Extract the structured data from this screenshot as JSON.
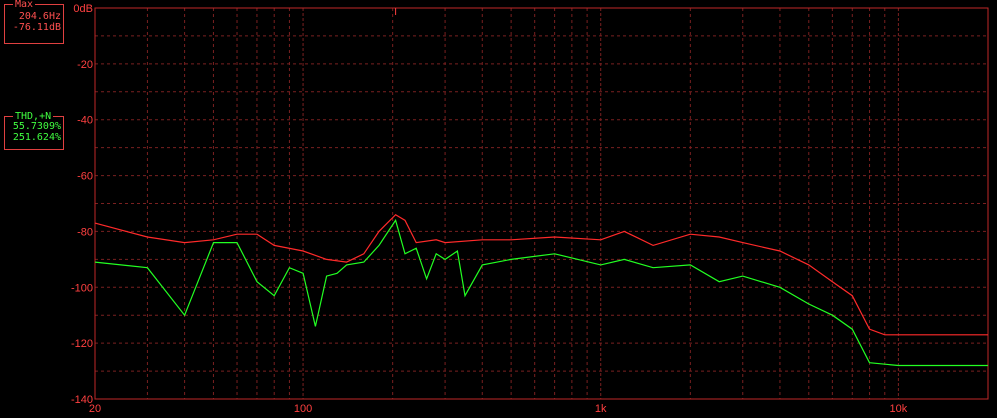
{
  "max_panel": {
    "title": "Max",
    "freq": "204.6Hz",
    "level": "-76.11dB"
  },
  "thd_panel": {
    "title": "THD,+N",
    "value1": "55.7309%",
    "value2": "251.624%"
  },
  "colors": {
    "background": "#000000",
    "grid": "#7a2020",
    "red_trace": "#ff2a2a",
    "green_trace": "#22ff22",
    "label": "#ff4040"
  },
  "chart_data": {
    "type": "line",
    "xscale": "log",
    "xlim": [
      20,
      20000
    ],
    "ylim": [
      -140,
      0
    ],
    "grid": true,
    "x_tick_labels": [
      {
        "x": 20,
        "label": "20"
      },
      {
        "x": 100,
        "label": "100"
      },
      {
        "x": 1000,
        "label": "1k"
      },
      {
        "x": 10000,
        "label": "10k"
      }
    ],
    "y_tick_labels": [
      {
        "y": 0,
        "label": "0dB"
      },
      {
        "y": -20,
        "label": "-20"
      },
      {
        "y": -40,
        "label": "-40"
      },
      {
        "y": -60,
        "label": "-60"
      },
      {
        "y": -80,
        "label": "-80"
      },
      {
        "y": -100,
        "label": "-100"
      },
      {
        "y": -120,
        "label": "-120"
      },
      {
        "y": -140,
        "label": "-140"
      }
    ],
    "marker_x": 204.6,
    "series": [
      {
        "color": "#ff2a2a",
        "x": [
          20,
          30,
          40,
          50,
          60,
          70,
          80,
          100,
          120,
          140,
          160,
          180,
          204.6,
          220,
          240,
          280,
          300,
          400,
          500,
          700,
          1000,
          1200,
          1500,
          2000,
          2500,
          3000,
          4000,
          5000,
          6000,
          7000,
          8000,
          9000,
          10000,
          12000,
          15000,
          20000
        ],
        "y": [
          -77,
          -82,
          -84,
          -83,
          -81,
          -81,
          -85,
          -87,
          -90,
          -91,
          -88,
          -80,
          -74,
          -76,
          -84,
          -83,
          -84,
          -83,
          -83,
          -82,
          -83,
          -80,
          -85,
          -81,
          -82,
          -84,
          -87,
          -92,
          -98,
          -103,
          -115,
          -117,
          -117,
          -117,
          -117,
          -117
        ]
      },
      {
        "color": "#22ff22",
        "x": [
          20,
          30,
          40,
          50,
          60,
          70,
          80,
          90,
          100,
          110,
          120,
          130,
          140,
          160,
          180,
          204.6,
          220,
          240,
          260,
          280,
          300,
          330,
          350,
          400,
          500,
          700,
          1000,
          1200,
          1500,
          2000,
          2500,
          3000,
          4000,
          5000,
          6000,
          7000,
          8000,
          10000,
          12000,
          15000,
          20000
        ],
        "y": [
          -91,
          -93,
          -110,
          -84,
          -84,
          -98,
          -103,
          -93,
          -95,
          -114,
          -96,
          -95,
          -92,
          -91,
          -85,
          -76,
          -88,
          -86,
          -97,
          -88,
          -90,
          -87,
          -103,
          -92,
          -90,
          -88,
          -92,
          -90,
          -93,
          -92,
          -98,
          -96,
          -100,
          -106,
          -110,
          -115,
          -127,
          -128,
          -128,
          -128,
          -128
        ]
      }
    ]
  }
}
